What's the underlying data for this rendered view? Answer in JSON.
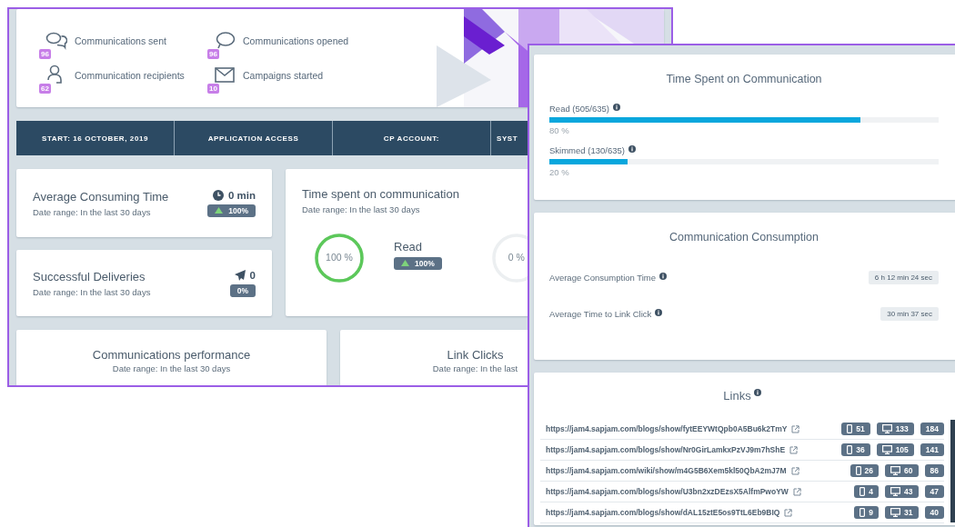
{
  "dashboard": {
    "summary_stats": [
      {
        "kind": "chat",
        "count": "96",
        "label": "Communications sent"
      },
      {
        "kind": "bubble",
        "count": "96",
        "label": "Communications opened"
      },
      {
        "kind": "user",
        "count": "62",
        "label": "Communication recipients"
      },
      {
        "kind": "mail",
        "count": "10",
        "label": "Campaigns started"
      }
    ],
    "info_bar": [
      "START: 16 OCTOBER, 2019",
      "APPLICATION ACCESS",
      "CP ACCOUNT:",
      "SYST"
    ],
    "metrics": [
      {
        "title": "Average Consuming Time",
        "subtitle": "Date range: In the last 30 days",
        "kind": "clock",
        "value": "0 min",
        "change": {
          "text": "100%",
          "kind": "up"
        }
      },
      {
        "title": "Successful Deliveries",
        "subtitle": "Date range: In the last 30 days",
        "kind": "plane",
        "value": "0",
        "change": {
          "text": "0%",
          "kind": "plain"
        }
      }
    ],
    "time_spent": {
      "title": "Time spent on communication",
      "subtitle": "Date range: In the last 30 days",
      "rings": [
        {
          "reading": "100 %",
          "level": 1,
          "label": "Read",
          "change": {
            "text": "100%",
            "kind": "up"
          }
        },
        {
          "reading": "0 %",
          "level": 0
        }
      ]
    },
    "bottom_cards": [
      {
        "title": "Communications performance",
        "subtitle": "Date range: In the last 30 days"
      },
      {
        "title": "Link Clicks",
        "subtitle": "Date range: In the last"
      }
    ]
  },
  "detail_panel": {
    "time_spent": {
      "title": "Time Spent on Communication",
      "bars": [
        {
          "label": "Read (505/635)",
          "level": 0.8,
          "reading": "80 %"
        },
        {
          "label": "Skimmed (130/635)",
          "level": 0.2,
          "reading": "20 %"
        }
      ]
    },
    "consumption": {
      "title": "Communication Consumption",
      "rows": [
        {
          "label": "Average Consumption Time",
          "value": "6 h 12 min 24 sec"
        },
        {
          "label": "Average Time to Link Click",
          "value": "30 min 37 sec"
        }
      ]
    },
    "links": {
      "title": "Links",
      "rows": [
        {
          "url": "https://jam4.sapjam.com/blogs/show/fytEEYWtQpb0A5Bu6k2TmY",
          "mobile": "51",
          "desktop": "133",
          "total": "184"
        },
        {
          "url": "https://jam4.sapjam.com/blogs/show/Nr0GirLamkxPzVJ9m7hShE",
          "mobile": "36",
          "desktop": "105",
          "total": "141"
        },
        {
          "url": "https://jam4.sapjam.com/wiki/show/m4G5B6Xem5kl50QbA2mJ7M",
          "mobile": "26",
          "desktop": "60",
          "total": "86"
        },
        {
          "url": "https://jam4.sapjam.com/blogs/show/U3bn2xzDEzsX5AlfmPwoYW",
          "mobile": "4",
          "desktop": "43",
          "total": "47"
        },
        {
          "url": "https://jam4.sapjam.com/blogs/show/dAL15ztE5os9TtL6Eb9BIQ",
          "mobile": "9",
          "desktop": "31",
          "total": "40"
        }
      ]
    }
  }
}
